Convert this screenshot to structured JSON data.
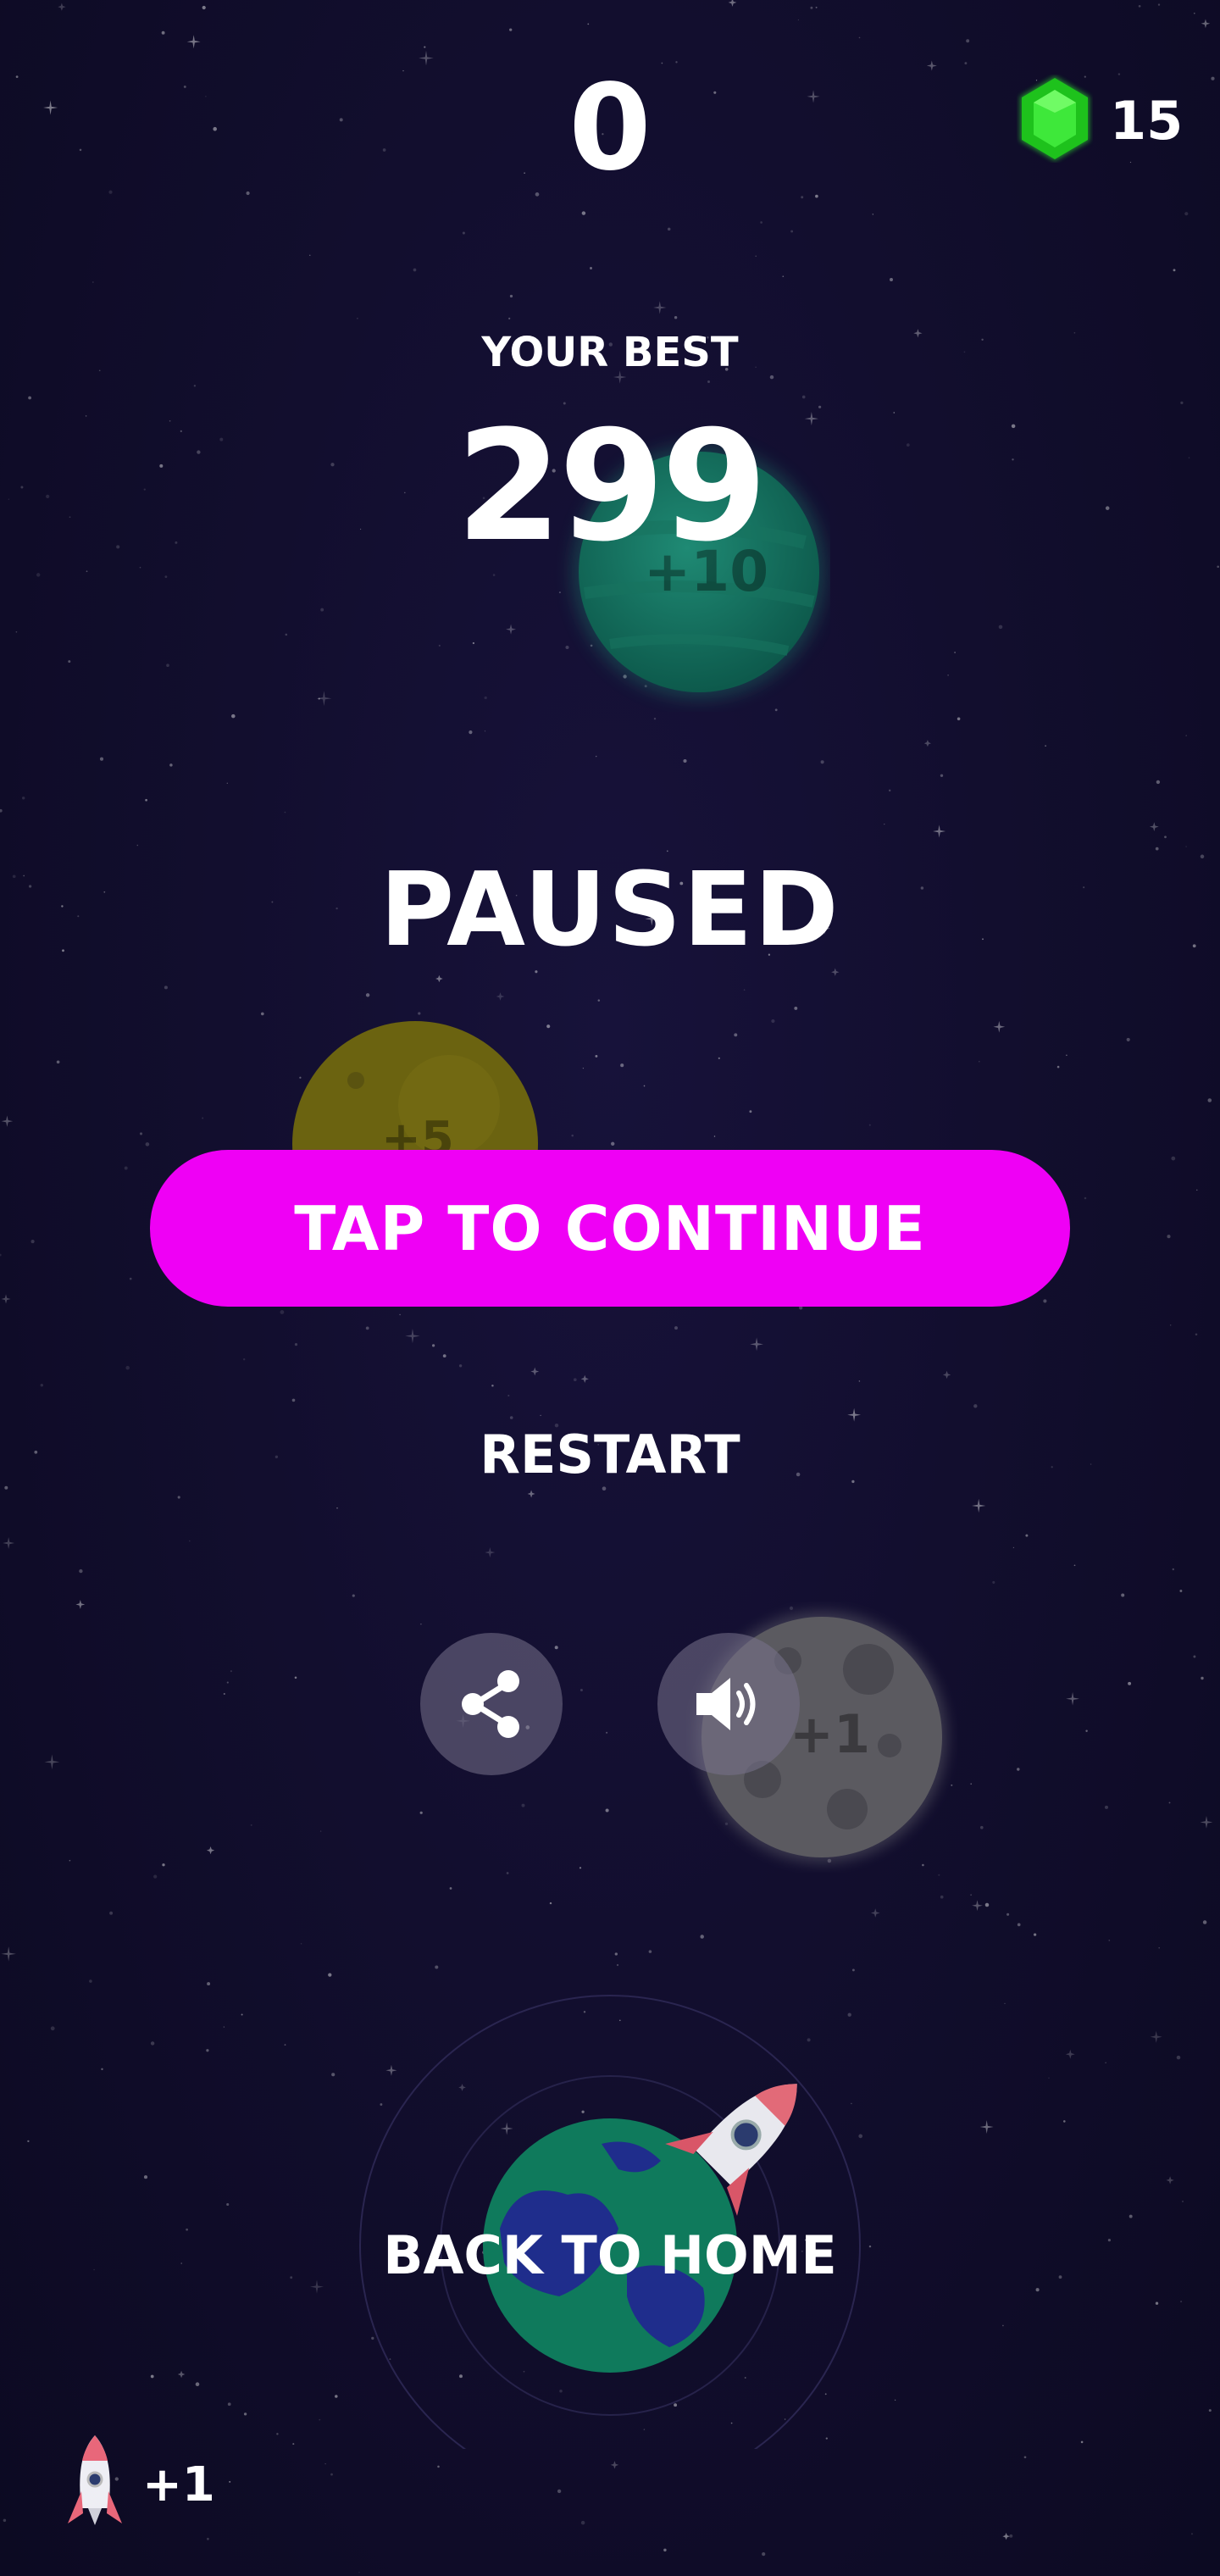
{
  "hud": {
    "score": "0",
    "gems": "15"
  },
  "best": {
    "label": "YOUR BEST",
    "value": "299"
  },
  "pause": {
    "title": "PAUSED",
    "continue_label": "TAP TO CONTINUE",
    "restart_label": "RESTART",
    "home_label": "BACK TO HOME"
  },
  "planets": {
    "green_bonus": "+10",
    "yellow_bonus": "+5",
    "moon_bonus": "+1"
  },
  "bottom": {
    "rocket_bonus": "+1"
  },
  "icons": {
    "gem": "gem-icon",
    "share": "share-icon",
    "sound": "speaker-icon",
    "rocket": "rocket-icon"
  },
  "colors": {
    "background": "#120e2e",
    "continue_button": "#ef00f5",
    "gem": "#2ee82a"
  }
}
